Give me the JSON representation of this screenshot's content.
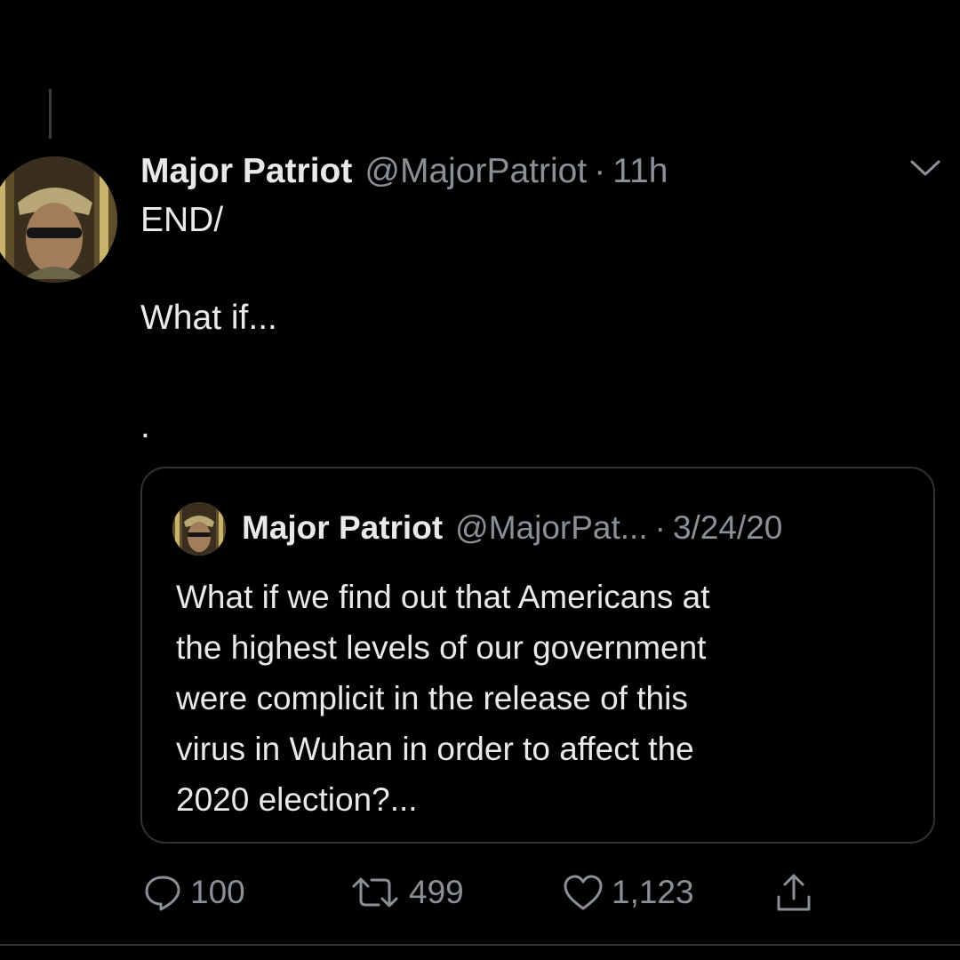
{
  "tweet": {
    "author_name": "Major Patriot",
    "handle": "@MajorPatriot",
    "separator": "·",
    "time": "11h",
    "lines": [
      "END/",
      "What if...",
      "."
    ]
  },
  "quote": {
    "author_name": "Major Patriot",
    "handle": "@MajorPat...",
    "separator": "·",
    "date": "3/24/20",
    "text": "What if we find out that Americans at\nthe highest levels of our government\nwere complicit in the release of this\nvirus in Wuhan in order to affect the\n2020 election?..."
  },
  "actions": {
    "reply_count": "100",
    "retweet_count": "499",
    "like_count": "1,123"
  },
  "icons": {
    "chevron": "chevron-down-icon",
    "reply": "reply-icon",
    "retweet": "retweet-icon",
    "like": "heart-icon",
    "share": "share-icon"
  },
  "colors": {
    "background": "#000000",
    "text": "#e7e9ea",
    "secondary": "#8b9096",
    "border": "#2f3336"
  }
}
